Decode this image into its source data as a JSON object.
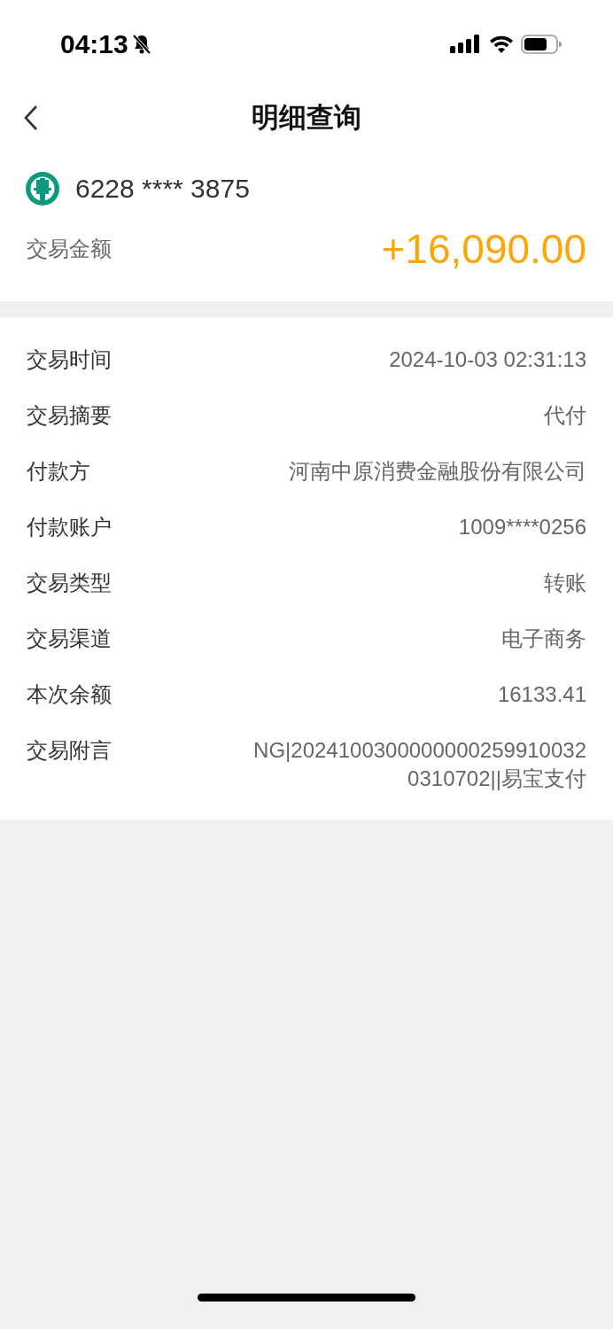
{
  "status_bar": {
    "time": "04:13",
    "silent": true
  },
  "header": {
    "title": "明细查询"
  },
  "account": {
    "number": "6228 **** 3875"
  },
  "amount": {
    "label": "交易金额",
    "value": "+16,090.00"
  },
  "details": [
    {
      "label": "交易时间",
      "value": "2024-10-03 02:31:13"
    },
    {
      "label": "交易摘要",
      "value": "代付"
    },
    {
      "label": "付款方",
      "value": "河南中原消费金融股份有限公司"
    },
    {
      "label": "付款账户",
      "value": "1009****0256"
    },
    {
      "label": "交易类型",
      "value": "转账"
    },
    {
      "label": "交易渠道",
      "value": "电子商务"
    },
    {
      "label": "本次余额",
      "value": "16133.41"
    },
    {
      "label": "交易附言",
      "value": "NG|20241003000000002599100320310702||易宝支付"
    }
  ]
}
